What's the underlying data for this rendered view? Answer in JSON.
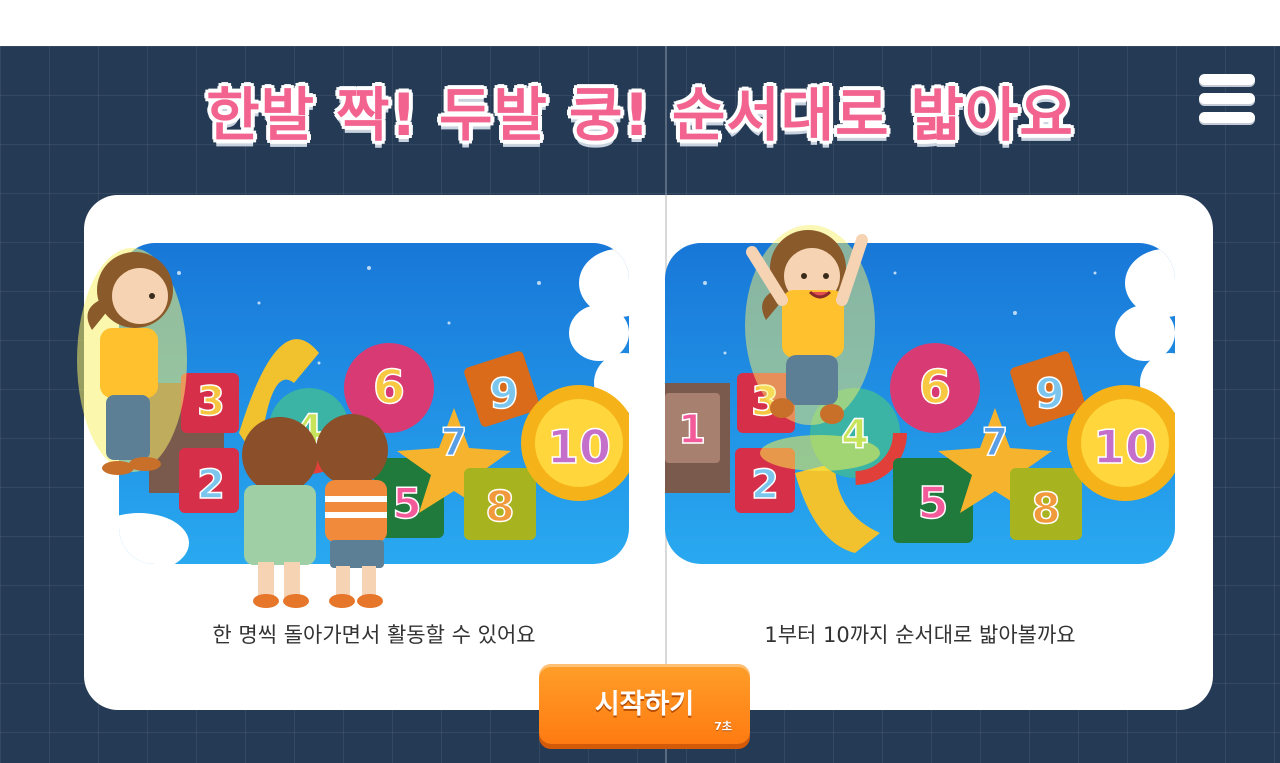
{
  "title": "한발 짝! 두발 쿵! 순서대로 밟아요",
  "menu": {
    "icon": "hamburger-menu-icon"
  },
  "panels": [
    {
      "caption": "한 명씩 돌아가면서 활동할 수 있어요",
      "scene": "kids-waiting-in-line"
    },
    {
      "caption": "1부터 10까지 순서대로 밟아볼까요",
      "scene": "girl-jumping-on-blocks"
    }
  ],
  "blocks": {
    "left": [
      "3",
      "2",
      "4",
      "5",
      "6",
      "9",
      "7",
      "8",
      "10"
    ],
    "right": [
      "1",
      "3",
      "2",
      "4",
      "5",
      "6",
      "9",
      "7",
      "8",
      "10"
    ]
  },
  "start_button": {
    "label": "시작하기",
    "countdown": "7초"
  },
  "colors": {
    "background": "#253a55",
    "title": "#f2648f",
    "accent": "#ff8c1a",
    "card": "#ffffff"
  }
}
